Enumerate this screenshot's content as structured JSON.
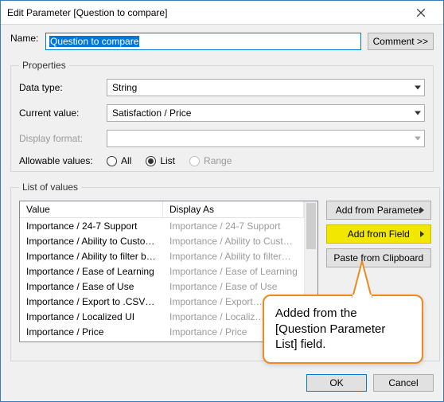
{
  "window": {
    "title": "Edit Parameter [Question to compare]"
  },
  "name": {
    "label": "Name:",
    "value": "Question to compare"
  },
  "comment_btn": "Comment >>",
  "properties": {
    "legend": "Properties",
    "data_type": {
      "label": "Data type:",
      "value": "String"
    },
    "current_value": {
      "label": "Current value:",
      "value": "Satisfaction / Price"
    },
    "display_format": {
      "label": "Display format:",
      "value": ""
    },
    "allowable": {
      "label": "Allowable values:",
      "options": {
        "all": "All",
        "list": "List",
        "range": "Range"
      },
      "selected": "list"
    }
  },
  "lov": {
    "legend": "List of values",
    "headers": {
      "value": "Value",
      "display_as": "Display As"
    },
    "rows": [
      {
        "value": "Importance / 24-7 Support",
        "display": "Importance / 24-7 Support"
      },
      {
        "value": "Importance / Ability to Customiz..",
        "display": "Importance / Ability to Cust…"
      },
      {
        "value": "Importance / Ability to filter bas..",
        "display": "Importance / Ability to filter…"
      },
      {
        "value": "Importance / Ease of Learning",
        "display": "Importance / Ease of Learning"
      },
      {
        "value": "Importance / Ease of Use",
        "display": "Importance / Ease of Use"
      },
      {
        "value": "Importance / Export to .CSV and..",
        "display": "Importance / Export…"
      },
      {
        "value": "Importance / Localized UI",
        "display": "Importance / Localiz…"
      },
      {
        "value": "Importance / Price",
        "display": "Importance / Price"
      }
    ],
    "buttons": {
      "add_from_parameter": "Add from Parameter",
      "add_from_field": "Add from Field",
      "paste_from_clipboard": "Paste from Clipboard"
    }
  },
  "footer": {
    "ok": "OK",
    "cancel": "Cancel"
  },
  "callout": "Added from the [Question Parameter List] field."
}
